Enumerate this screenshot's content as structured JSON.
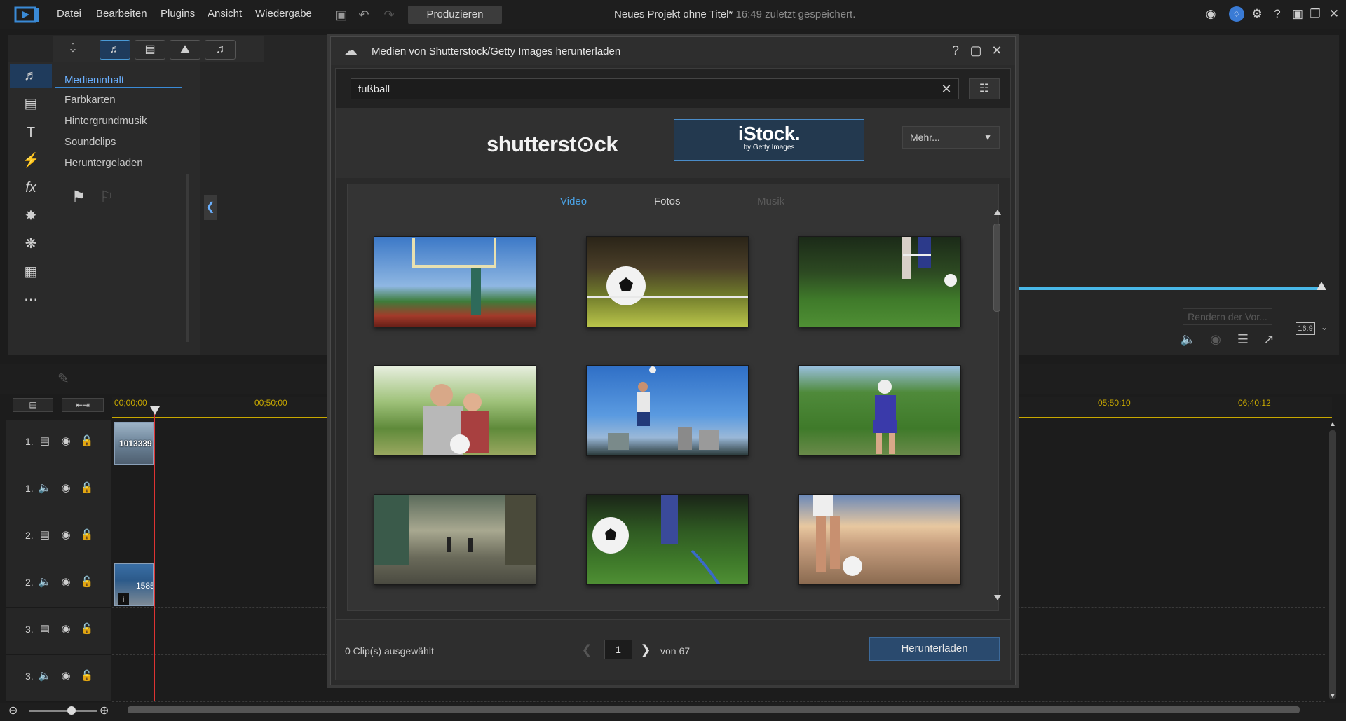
{
  "menubar": {
    "items": [
      "Datei",
      "Bearbeiten",
      "Plugins",
      "Ansicht",
      "Wiedergabe"
    ],
    "produce_label": "Produzieren",
    "project_title": "Neues Projekt ohne Titel*",
    "saved_status": "16:49 zuletzt gespeichert."
  },
  "library": {
    "tree": [
      "Medieninhalt",
      "Farbkarten",
      "Hintergrundmusik",
      "Soundclips",
      "Heruntergeladen"
    ]
  },
  "preview": {
    "render_label": "Rendern der Vor...",
    "aspect_label": "16:9"
  },
  "timeline": {
    "ruler": [
      "00;00;00",
      "00;50;00",
      "05;50;10",
      "06;40;12"
    ],
    "tracks": [
      "1.",
      "1.",
      "2.",
      "2.",
      "3.",
      "3."
    ],
    "clip1_label": "1013339",
    "clip2_label": "1585"
  },
  "dialog": {
    "title": "Medien von Shutterstock/Getty Images herunterladen",
    "search_value": "fußball",
    "shutterstock_label": "shutterst⊙ck",
    "istock_brand": "iStock.",
    "istock_sub": "by Getty Images",
    "more_label": "Mehr...",
    "tabs": {
      "video": "Video",
      "photos": "Fotos",
      "music": "Musik"
    },
    "clips_selected": "0 Clip(s) ausgewählt",
    "page": "1",
    "page_of": "von 67",
    "download_label": "Herunterladen"
  },
  "colors": {
    "accent": "#4a9ad6",
    "active_tab": "#4aa3e6",
    "disabled_tab": "#5a5a5a",
    "timeline_yellow": "#c8a800",
    "playhead": "#dd3333"
  }
}
